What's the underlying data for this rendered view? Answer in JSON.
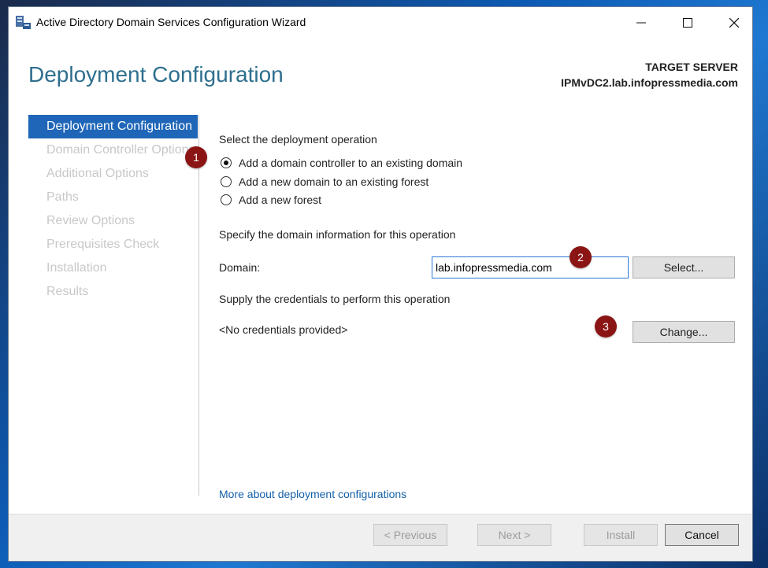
{
  "window": {
    "title": "Active Directory Domain Services Configuration Wizard"
  },
  "header": {
    "page_title": "Deployment Configuration",
    "target_label": "TARGET SERVER",
    "target_host": "IPMvDC2.lab.infopressmedia.com"
  },
  "nav": {
    "items": [
      {
        "label": "Deployment Configuration",
        "active": true
      },
      {
        "label": "Domain Controller Options",
        "active": false
      },
      {
        "label": "Additional Options",
        "active": false
      },
      {
        "label": "Paths",
        "active": false
      },
      {
        "label": "Review Options",
        "active": false
      },
      {
        "label": "Prerequisites Check",
        "active": false
      },
      {
        "label": "Installation",
        "active": false
      },
      {
        "label": "Results",
        "active": false
      }
    ]
  },
  "deployment": {
    "heading": "Select the deployment operation",
    "options": [
      {
        "label": "Add a domain controller to an existing domain",
        "checked": true
      },
      {
        "label": "Add a new domain to an existing forest",
        "checked": false
      },
      {
        "label": "Add a new forest",
        "checked": false
      }
    ]
  },
  "domain": {
    "heading": "Specify the domain information for this operation",
    "label": "Domain:",
    "value": "lab.infopressmedia.com",
    "select_button": "Select..."
  },
  "credentials": {
    "heading": "Supply the credentials to perform this operation",
    "status": "<No credentials provided>",
    "change_button": "Change..."
  },
  "more_link": "More about deployment configurations",
  "badges": [
    "1",
    "2",
    "3"
  ],
  "footer": {
    "previous": "< Previous",
    "next": "Next >",
    "install": "Install",
    "cancel": "Cancel"
  },
  "colors": {
    "accent": "#1f66b8",
    "title": "#2e6f8e",
    "badge": "#8b1515",
    "link": "#1560a8"
  }
}
